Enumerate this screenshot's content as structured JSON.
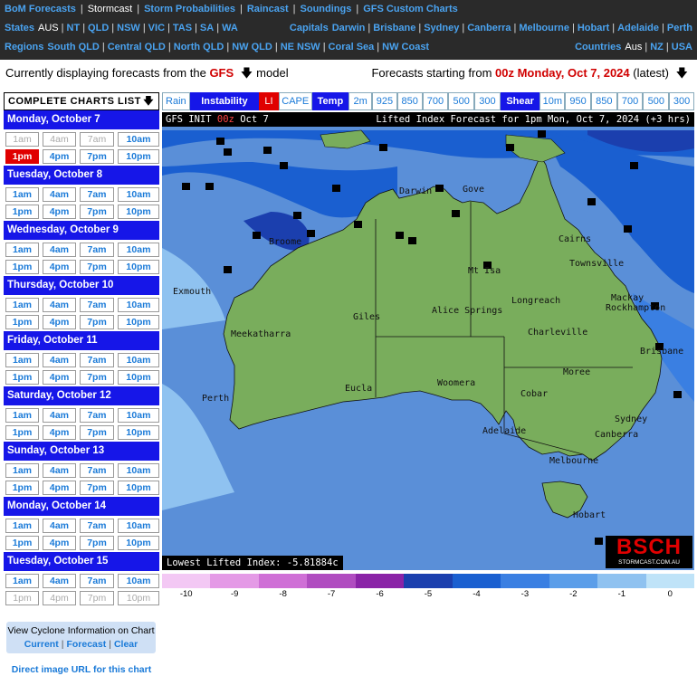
{
  "nav": {
    "row1": [
      "BoM Forecasts",
      "Stormcast",
      "Storm Probabilities",
      "Raincast",
      "Soundings",
      "GFS Custom Charts"
    ],
    "row1_current_index": 1,
    "states_label": "States",
    "states": [
      "AUS",
      "NT",
      "QLD",
      "NSW",
      "VIC",
      "TAS",
      "SA",
      "WA"
    ],
    "capitals_label": "Capitals",
    "capitals": [
      "Darwin",
      "Brisbane",
      "Sydney",
      "Canberra",
      "Melbourne",
      "Hobart",
      "Adelaide",
      "Perth"
    ],
    "regions_label": "Regions",
    "regions": [
      "South QLD",
      "Central QLD",
      "North QLD",
      "NW QLD",
      "NE NSW",
      "Coral Sea",
      "NW Coast"
    ],
    "countries_label": "Countries",
    "countries": [
      "Aus",
      "NZ",
      "USA"
    ]
  },
  "model_line": {
    "prefix": "Currently displaying forecasts from the",
    "model": "GFS",
    "suffix": "model",
    "start_prefix": "Forecasts starting from",
    "start_value": "00z Monday, Oct 7, 2024",
    "start_suffix": "(latest)"
  },
  "chart_list": {
    "header": "COMPLETE CHARTS LIST",
    "days": [
      {
        "label": "Monday, October 7",
        "times": [
          "1am",
          "4am",
          "7am",
          "10am",
          "1pm",
          "4pm",
          "7pm",
          "10pm"
        ],
        "disabled": [
          0,
          1,
          2
        ],
        "selected": 4
      },
      {
        "label": "Tuesday, October 8",
        "times": [
          "1am",
          "4am",
          "7am",
          "10am",
          "1pm",
          "4pm",
          "7pm",
          "10pm"
        ],
        "disabled": [],
        "selected": -1
      },
      {
        "label": "Wednesday, October 9",
        "times": [
          "1am",
          "4am",
          "7am",
          "10am",
          "1pm",
          "4pm",
          "7pm",
          "10pm"
        ],
        "disabled": [],
        "selected": -1
      },
      {
        "label": "Thursday, October 10",
        "times": [
          "1am",
          "4am",
          "7am",
          "10am",
          "1pm",
          "4pm",
          "7pm",
          "10pm"
        ],
        "disabled": [],
        "selected": -1
      },
      {
        "label": "Friday, October 11",
        "times": [
          "1am",
          "4am",
          "7am",
          "10am",
          "1pm",
          "4pm",
          "7pm",
          "10pm"
        ],
        "disabled": [],
        "selected": -1
      },
      {
        "label": "Saturday, October 12",
        "times": [
          "1am",
          "4am",
          "7am",
          "10am",
          "1pm",
          "4pm",
          "7pm",
          "10pm"
        ],
        "disabled": [],
        "selected": -1
      },
      {
        "label": "Sunday, October 13",
        "times": [
          "1am",
          "4am",
          "7am",
          "10am",
          "1pm",
          "4pm",
          "7pm",
          "10pm"
        ],
        "disabled": [],
        "selected": -1
      },
      {
        "label": "Monday, October 14",
        "times": [
          "1am",
          "4am",
          "7am",
          "10am",
          "1pm",
          "4pm",
          "7pm",
          "10pm"
        ],
        "disabled": [],
        "selected": -1
      },
      {
        "label": "Tuesday, October 15",
        "times": [
          "1am",
          "4am",
          "7am",
          "10am",
          "1pm",
          "4pm",
          "7pm",
          "10pm"
        ],
        "disabled": [
          4,
          5,
          6,
          7
        ],
        "selected": -1
      }
    ]
  },
  "cyclone": {
    "title": "View Cyclone Information on Chart",
    "links": [
      "Current",
      "Forecast",
      "Clear"
    ]
  },
  "direct_url": "Direct image URL for this chart",
  "tabs": [
    {
      "label": "Rain",
      "state": "normal"
    },
    {
      "label": "Instability",
      "state": "active"
    },
    {
      "label": "LI",
      "state": "li"
    },
    {
      "label": "CAPE",
      "state": "normal"
    },
    {
      "label": "Temp",
      "state": "active"
    },
    {
      "label": "2m",
      "state": "normal"
    },
    {
      "label": "925",
      "state": "normal"
    },
    {
      "label": "850",
      "state": "normal"
    },
    {
      "label": "700",
      "state": "normal"
    },
    {
      "label": "500",
      "state": "normal"
    },
    {
      "label": "300",
      "state": "normal"
    },
    {
      "label": "Shear",
      "state": "active"
    },
    {
      "label": "10m",
      "state": "normal"
    },
    {
      "label": "950",
      "state": "normal"
    },
    {
      "label": "850",
      "state": "normal"
    },
    {
      "label": "700",
      "state": "normal"
    },
    {
      "label": "500",
      "state": "normal"
    },
    {
      "label": "300",
      "state": "normal"
    }
  ],
  "map": {
    "init_prefix": "GFS INIT",
    "init_time": "00z",
    "init_date": "Oct 7",
    "forecast_title": "Lifted Index Forecast for 1pm Mon, Oct 7, 2024 (+3 hrs)",
    "lowest_li": "Lowest Lifted Index: -5.81884c",
    "logo": "BSCH",
    "logo_sub": "STORMCAST.COM.AU",
    "cities": [
      "Darwin",
      "Gove",
      "Cairns",
      "Townsville",
      "Mt Isa",
      "Broome",
      "Exmouth",
      "Alice Springs",
      "Longreach",
      "Mackay",
      "Rockhampton",
      "Giles",
      "Meekatharra",
      "Charleville",
      "Brisbane",
      "Moree",
      "Cobar",
      "Eucla",
      "Woomera",
      "Perth",
      "Sydney",
      "Canberra",
      "Adelaide",
      "Melbourne",
      "Hobart"
    ]
  },
  "legend": {
    "labels": [
      "-10",
      "-9",
      "-8",
      "-7",
      "-6",
      "-5",
      "-4",
      "-3",
      "-2",
      "-1",
      "0"
    ],
    "colors": [
      "#f3c8f4",
      "#e49ae6",
      "#cf6fd6",
      "#b04cc0",
      "#8a23a7",
      "#1b3fae",
      "#1a5fd0",
      "#3a7fe2",
      "#5b9ee9",
      "#8fc2f0",
      "#bfe3f8"
    ]
  },
  "colors": {
    "nav_bg": "#2a2a2a",
    "link": "#4aa3f0",
    "active_tab": "#1616e8",
    "selected": "#e00000",
    "land": "#79ad5c",
    "ocean": "#5a8fd8"
  }
}
